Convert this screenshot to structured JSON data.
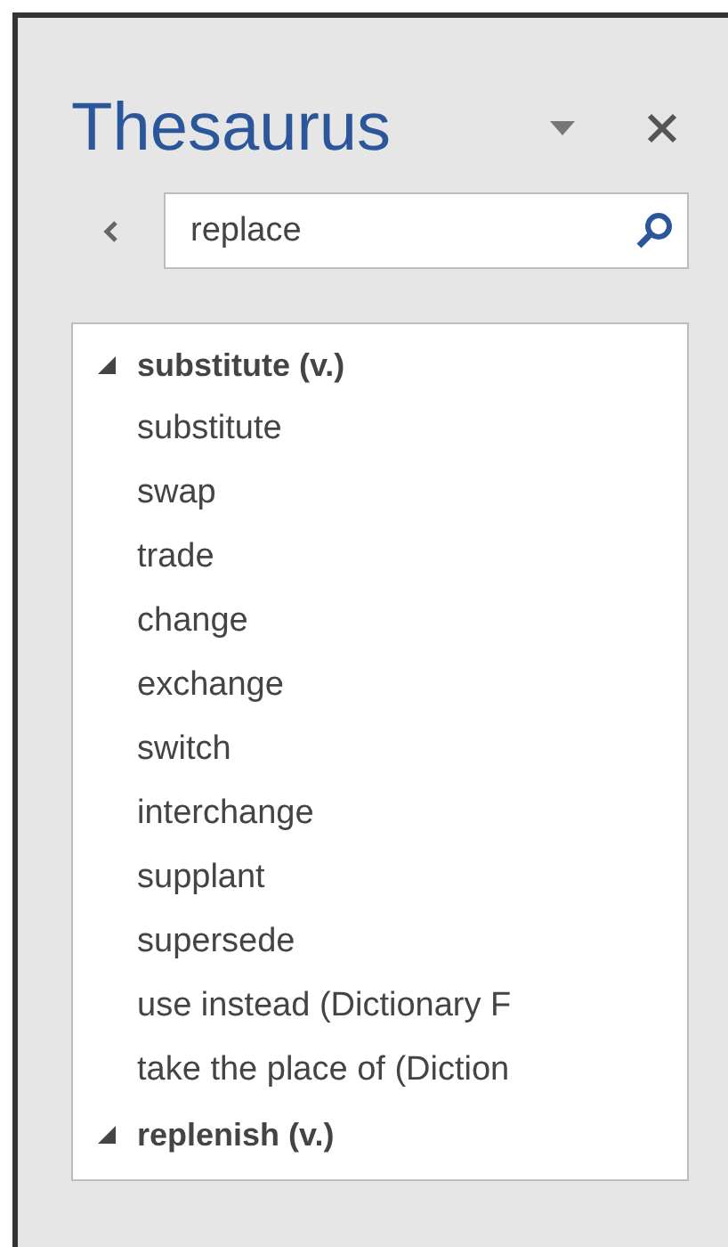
{
  "pane": {
    "title": "Thesaurus"
  },
  "search": {
    "value": "replace"
  },
  "results": [
    {
      "label": "substitute (v.)",
      "expanded": true,
      "children": [
        "substitute",
        "swap",
        "trade",
        "change",
        "exchange",
        "switch",
        "interchange",
        "supplant",
        "supersede",
        "use instead (Dictionary F",
        "take the place of (Diction"
      ]
    },
    {
      "label": "replenish (v.)",
      "expanded": true
    }
  ]
}
